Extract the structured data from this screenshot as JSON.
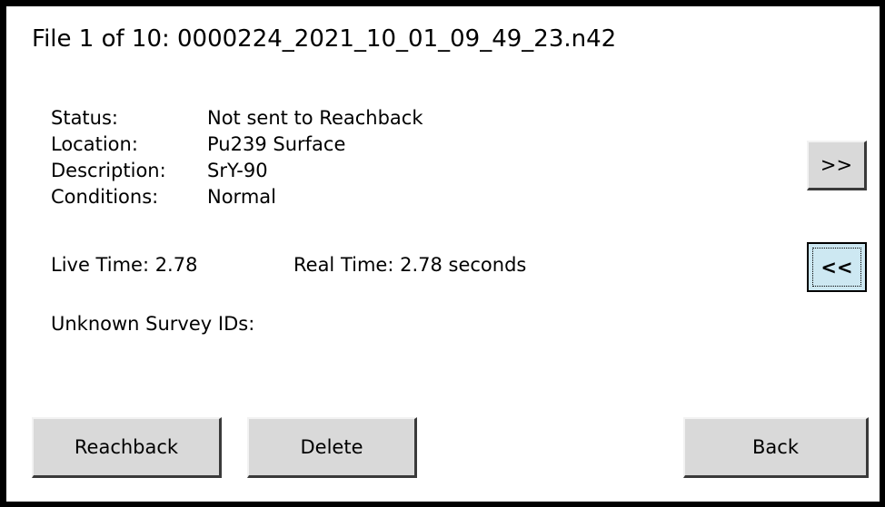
{
  "header": {
    "title": "File 1 of 10: 0000224_2021_10_01_09_49_23.n42"
  },
  "details": {
    "status_label": "Status:",
    "status_value": "Not sent to Reachback",
    "location_label": "Location:",
    "location_value": "Pu239 Surface",
    "description_label": "Description:",
    "description_value": "SrY-90",
    "conditions_label": "Conditions:",
    "conditions_value": "Normal"
  },
  "timing": {
    "live_time": "Live Time: 2.78",
    "real_time": "Real Time: 2.78 seconds"
  },
  "survey": {
    "unknown_ids": "Unknown Survey IDs:"
  },
  "navigation": {
    "next_label": ">>",
    "prev_label": "<<"
  },
  "actions": {
    "reachback_label": "Reachback",
    "delete_label": "Delete",
    "back_label": "Back"
  }
}
